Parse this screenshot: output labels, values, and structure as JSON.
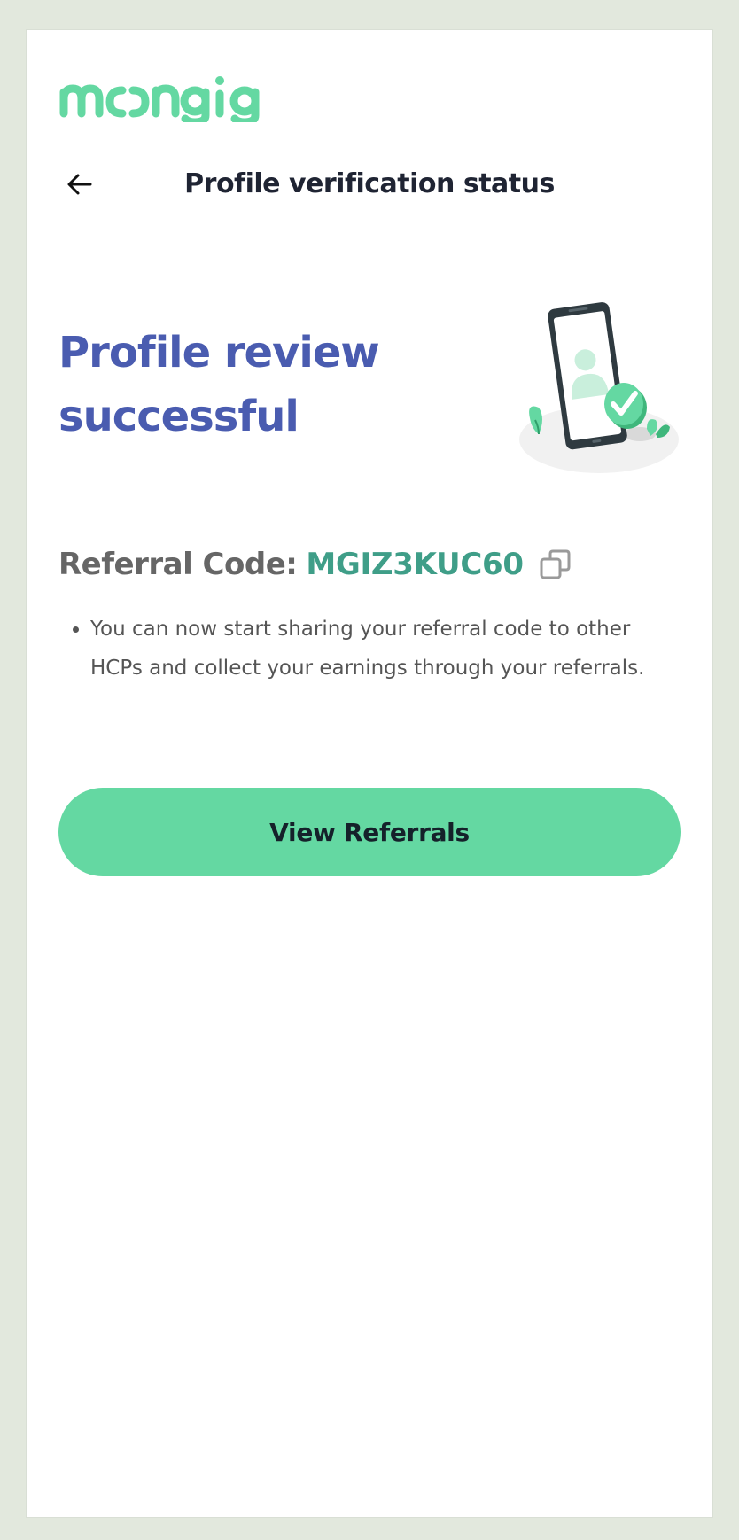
{
  "brand": {
    "name": "moongig",
    "logo_color": "#64d8a2"
  },
  "header": {
    "back_icon": "arrow-left-icon",
    "title": "Profile verification status"
  },
  "hero": {
    "title": "Profile review successful",
    "illustration": "phone-verified-illustration",
    "title_color": "#4a5cb0"
  },
  "referral": {
    "label": "Referral Code:",
    "code": "MGIZ3KUC60",
    "copy_icon": "copy-icon",
    "code_color": "#3f9e88",
    "bullets": [
      "You can now start sharing your referral code to other HCPs and collect your earnings through your referrals."
    ]
  },
  "cta": {
    "label": "View Referrals",
    "color": "#64d8a2"
  }
}
